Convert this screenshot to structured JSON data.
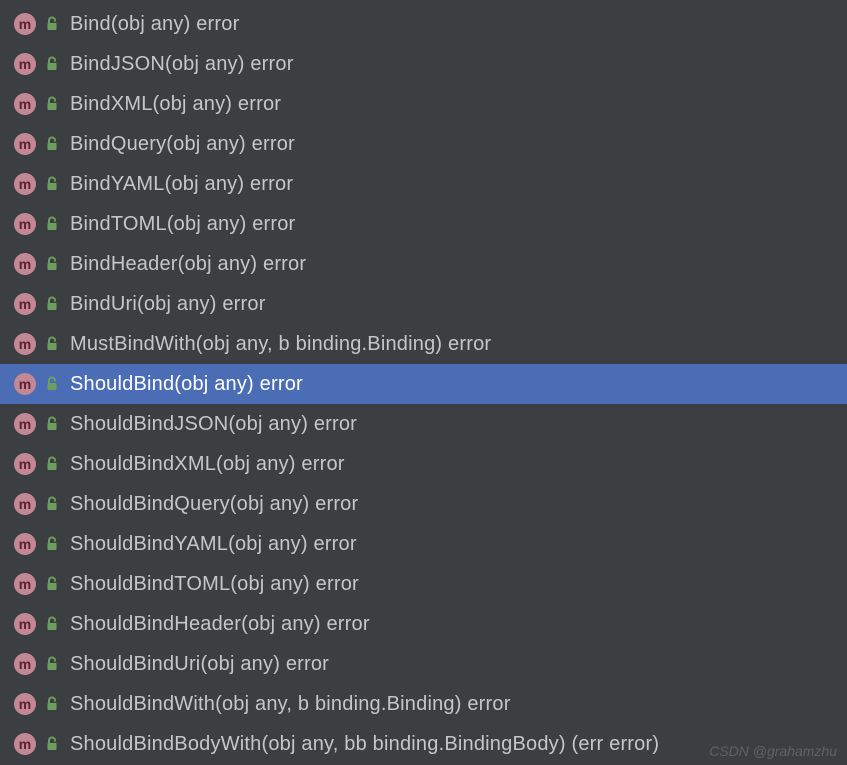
{
  "items": [
    {
      "label": "Bind(obj any) error",
      "selected": false
    },
    {
      "label": "BindJSON(obj any) error",
      "selected": false
    },
    {
      "label": "BindXML(obj any) error",
      "selected": false
    },
    {
      "label": "BindQuery(obj any) error",
      "selected": false
    },
    {
      "label": "BindYAML(obj any) error",
      "selected": false
    },
    {
      "label": "BindTOML(obj any) error",
      "selected": false
    },
    {
      "label": "BindHeader(obj any) error",
      "selected": false
    },
    {
      "label": "BindUri(obj any) error",
      "selected": false
    },
    {
      "label": "MustBindWith(obj any, b binding.Binding) error",
      "selected": false
    },
    {
      "label": "ShouldBind(obj any) error",
      "selected": true
    },
    {
      "label": "ShouldBindJSON(obj any) error",
      "selected": false
    },
    {
      "label": "ShouldBindXML(obj any) error",
      "selected": false
    },
    {
      "label": "ShouldBindQuery(obj any) error",
      "selected": false
    },
    {
      "label": "ShouldBindYAML(obj any) error",
      "selected": false
    },
    {
      "label": "ShouldBindTOML(obj any) error",
      "selected": false
    },
    {
      "label": "ShouldBindHeader(obj any) error",
      "selected": false
    },
    {
      "label": "ShouldBindUri(obj any) error",
      "selected": false
    },
    {
      "label": "ShouldBindWith(obj any, b binding.Binding) error",
      "selected": false
    },
    {
      "label": "ShouldBindBodyWith(obj any, bb binding.BindingBody) (err error)",
      "selected": false
    }
  ],
  "method_icon_letter": "m",
  "watermark": "CSDN @grahamzhu"
}
